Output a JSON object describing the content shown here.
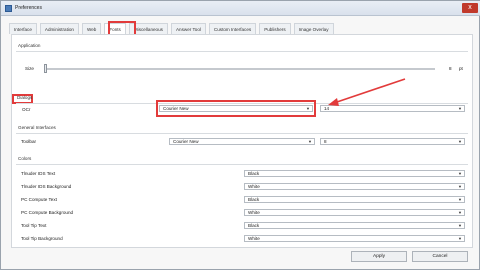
{
  "window": {
    "title": "Preferences",
    "close_label": "x"
  },
  "tabs": [
    {
      "label": "Interface",
      "active": false
    },
    {
      "label": "Administration",
      "active": false
    },
    {
      "label": "Web",
      "active": false
    },
    {
      "label": "Fonts",
      "active": true
    },
    {
      "label": "Miscellaneous",
      "active": false
    },
    {
      "label": "Answer Tool",
      "active": false
    },
    {
      "label": "Custom Interfaces",
      "active": false
    },
    {
      "label": "Publishers",
      "active": false
    },
    {
      "label": "Image Overlay",
      "active": false
    }
  ],
  "application": {
    "group_label": "Application",
    "size_label": "Size",
    "size_value": "8",
    "size_unit": "pt"
  },
  "dialogs": {
    "group_label": "Dialogs",
    "ocr_label": "OCr",
    "ocr_font": "Courier New",
    "ocr_size": "14"
  },
  "general": {
    "group_label": "General Interfaces",
    "toolbar_label": "Toolbar",
    "toolbar_font": "Courier New",
    "toolbar_size": "8"
  },
  "colors": {
    "group_label": "Colors",
    "rows": [
      {
        "label": "Tlnuder IDS Text",
        "value": "Black"
      },
      {
        "label": "Tlnuder IDS Background",
        "value": "White"
      },
      {
        "label": "PC Compute Text",
        "value": "Black"
      },
      {
        "label": "PC Compute Background",
        "value": "White"
      },
      {
        "label": "Tool Tip Text",
        "value": "Black"
      },
      {
        "label": "Tool Tip Background",
        "value": "White"
      }
    ]
  },
  "footer": {
    "apply_label": "Apply",
    "cancel_label": "Cancel"
  },
  "style": {
    "highlight": "#e23b3b"
  }
}
